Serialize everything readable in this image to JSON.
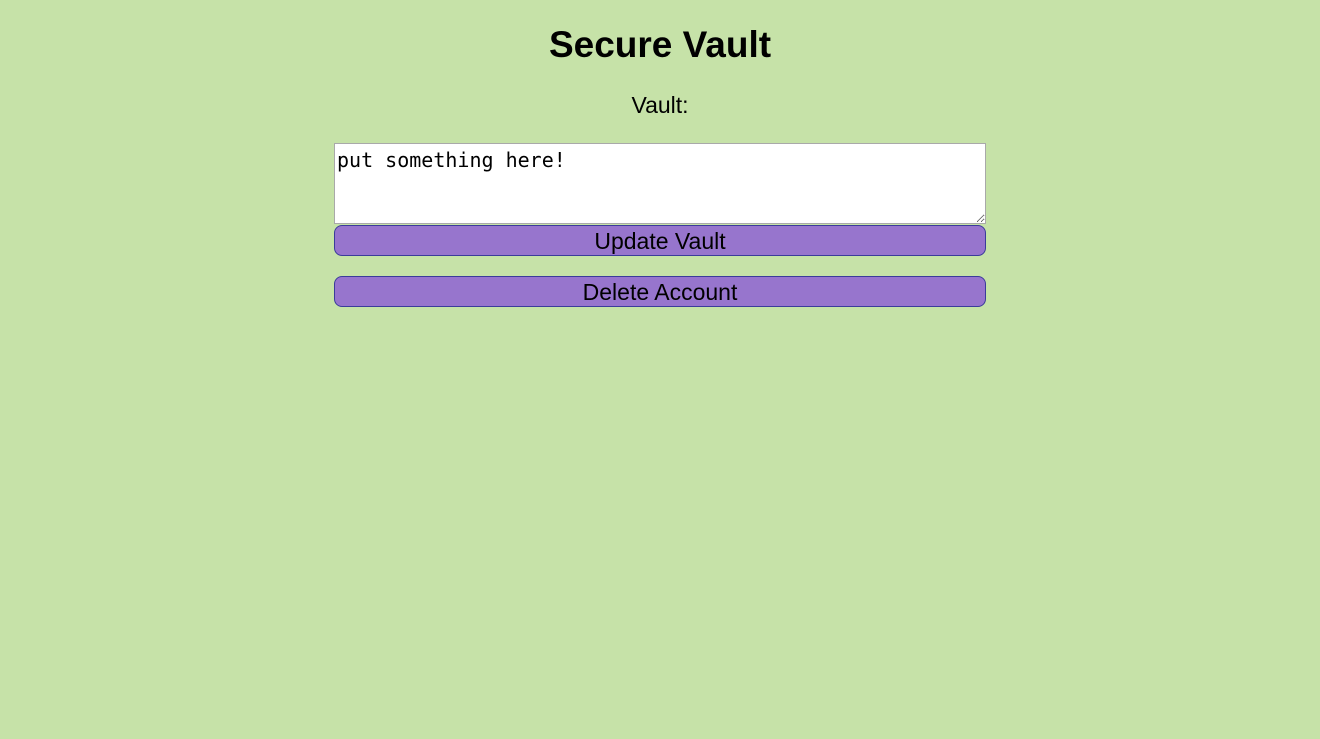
{
  "header": {
    "title": "Secure Vault"
  },
  "vault": {
    "label": "Vault:",
    "value": "put something here!"
  },
  "actions": {
    "update_label": "Update Vault",
    "delete_label": "Delete Account"
  },
  "colors": {
    "background": "#c6e2a8",
    "button": "#9775cd",
    "button_border": "#3b3b9b"
  }
}
